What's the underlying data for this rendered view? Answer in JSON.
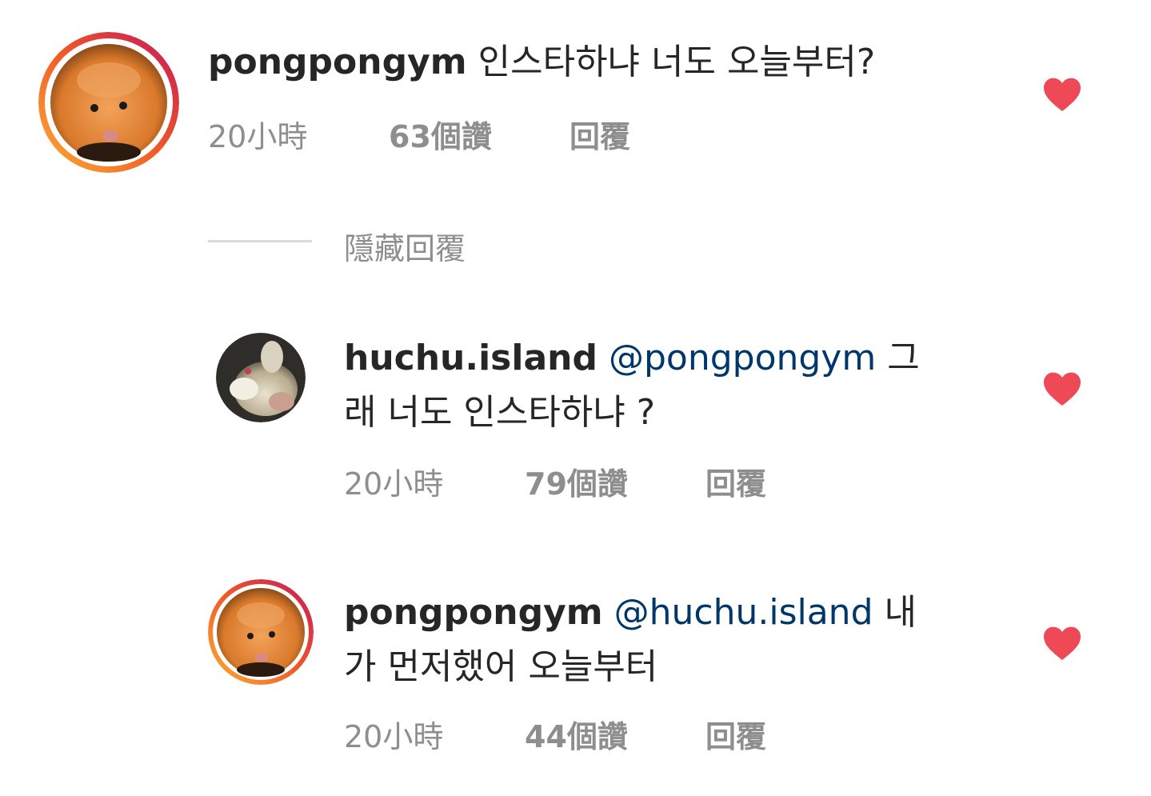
{
  "comments": [
    {
      "username": "pongpongym",
      "mention": "",
      "text_line1": "인스타하냐 너도 오늘부터?",
      "text_line2": "",
      "time": "20小時",
      "likes": "63個讚",
      "reply": "回覆",
      "liked": true
    },
    {
      "username": "huchu.island",
      "mention": "@pongpongym",
      "text_line1": "그",
      "text_line2": "래 너도 인스타하냐 ?",
      "time": "20小時",
      "likes": "79個讚",
      "reply": "回覆",
      "liked": true
    },
    {
      "username": "pongpongym",
      "mention": "@huchu.island",
      "text_line1": "내",
      "text_line2": "가 먼저했어 오늘부터",
      "time": "20小時",
      "likes": "44個讚",
      "reply": "回覆",
      "liked": true
    }
  ],
  "hide_replies_label": "隱藏回覆",
  "colors": {
    "heart": "#ed4956",
    "mention": "#00376b",
    "meta": "#8e8e8e",
    "story_ring_start": "#f9a825",
    "story_ring_end": "#c2185b"
  }
}
